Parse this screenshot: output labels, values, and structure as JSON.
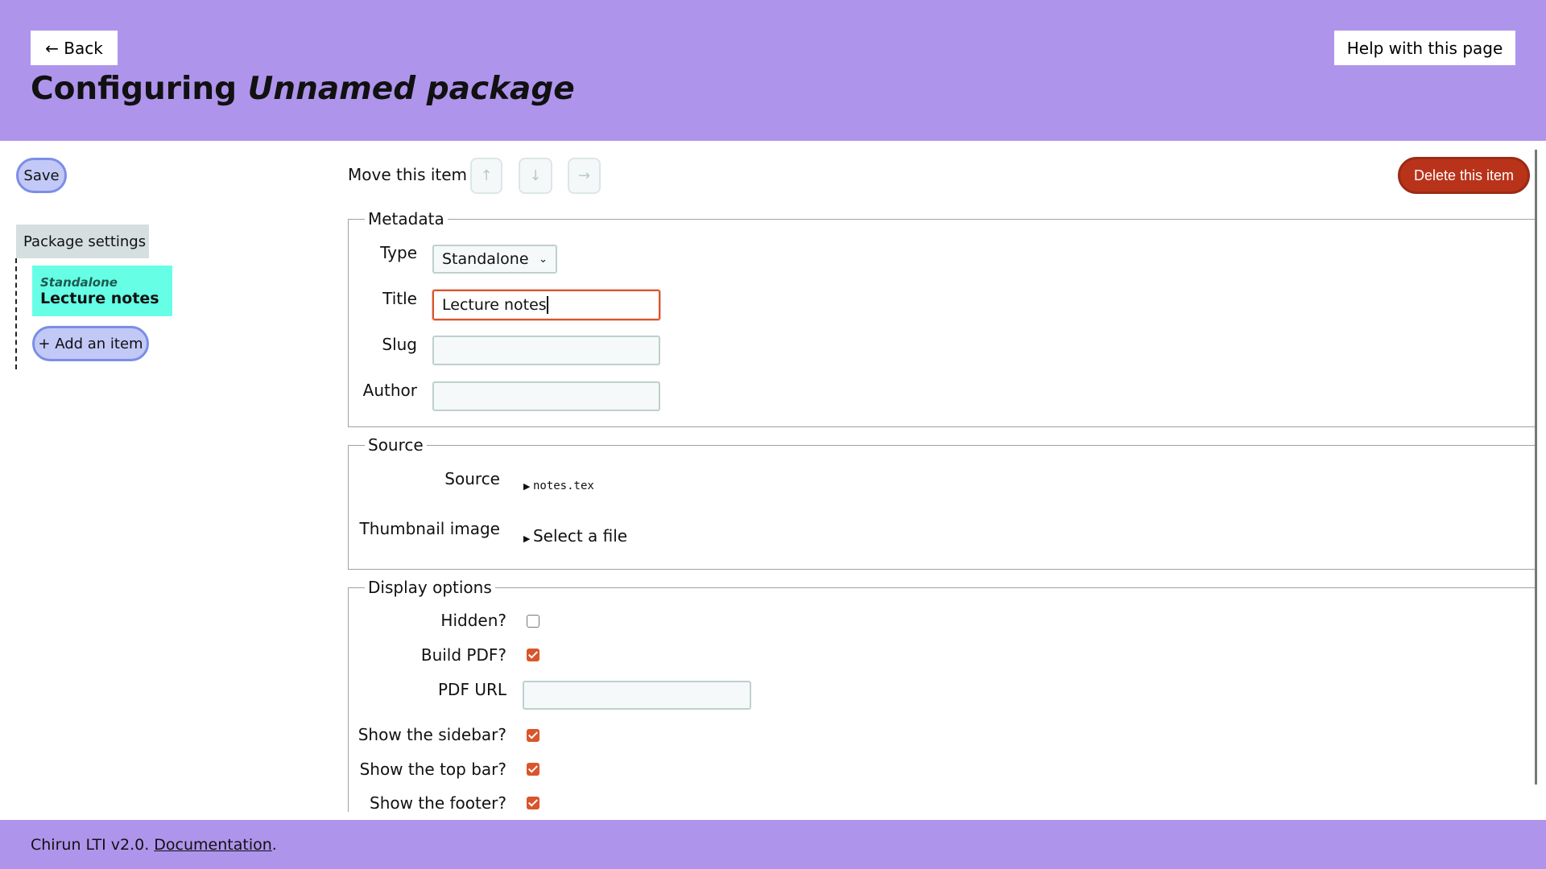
{
  "header": {
    "back_label": "← Back",
    "help_label": "Help with this page",
    "title_prefix": "Configuring ",
    "title_name": "Unnamed package"
  },
  "sidebar": {
    "save_label": "Save",
    "package_settings_label": "Package settings",
    "items": [
      {
        "type": "Standalone",
        "title": "Lecture notes",
        "selected": true
      }
    ],
    "add_item_label": "+ Add an item"
  },
  "toolbar": {
    "move_label": "Move this item",
    "up_icon": "↑",
    "down_icon": "↓",
    "right_icon": "→",
    "delete_label": "Delete this item"
  },
  "metadata": {
    "legend": "Metadata",
    "type_label": "Type",
    "type_value": "Standalone",
    "title_label": "Title",
    "title_value": "Lecture notes",
    "slug_label": "Slug",
    "slug_value": "",
    "author_label": "Author",
    "author_value": ""
  },
  "source": {
    "legend": "Source",
    "source_label": "Source",
    "source_value": "notes.tex",
    "thumbnail_label": "Thumbnail image",
    "thumbnail_value": "Select a file"
  },
  "display": {
    "legend": "Display options",
    "hidden_label": "Hidden?",
    "hidden": false,
    "build_pdf_label": "Build PDF?",
    "build_pdf": true,
    "pdf_url_label": "PDF URL",
    "pdf_url_value": "",
    "sidebar_label": "Show the sidebar?",
    "sidebar": true,
    "topbar_label": "Show the top bar?",
    "topbar": true,
    "footer_label": "Show the footer?",
    "footer": true
  },
  "footer": {
    "text": "Chirun LTI v2.0. ",
    "link": "Documentation",
    "end": "."
  },
  "colors": {
    "header": "#af94ec",
    "delete": "#b8331a",
    "checkbox": "#d9552c",
    "selected_item": "#66ffe6"
  }
}
